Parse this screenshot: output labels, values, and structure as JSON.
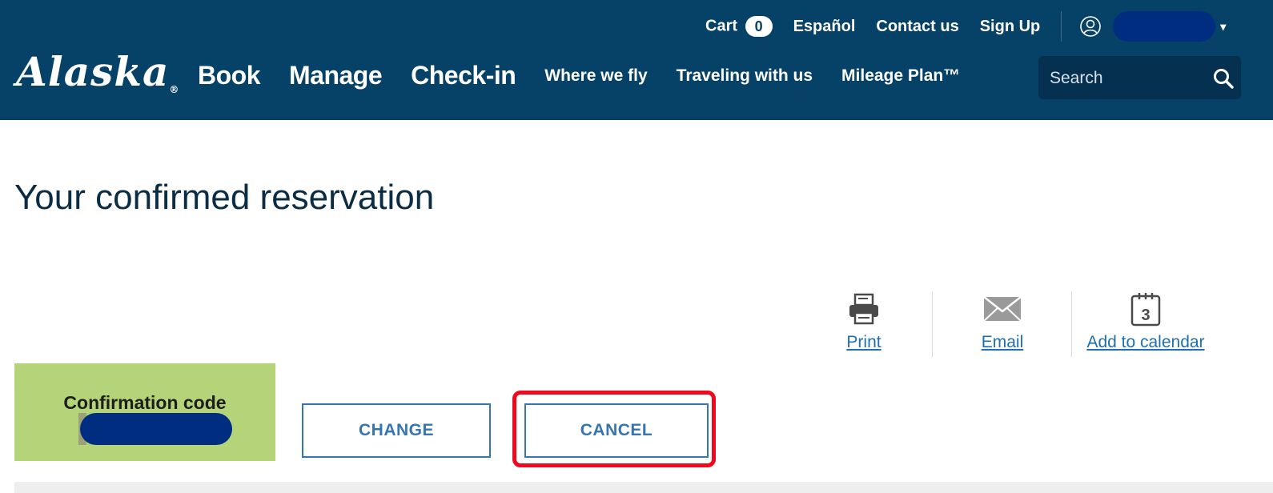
{
  "header": {
    "logo_text": "Alaska",
    "logo_mark": "®",
    "utility": {
      "cart_label": "Cart",
      "cart_count": "0",
      "espanol": "Español",
      "contact": "Contact us",
      "signup": "Sign Up",
      "user_icon": "user-circle-icon",
      "caret": "▾"
    },
    "nav": {
      "book": "Book",
      "manage": "Manage",
      "checkin": "Check-in",
      "where": "Where we fly",
      "traveling": "Traveling with us",
      "mileage": "Mileage Plan™"
    },
    "search": {
      "placeholder": "Search",
      "icon": "search-icon"
    }
  },
  "main": {
    "title": "Your confirmed reservation",
    "actions": {
      "print": "Print",
      "email": "Email",
      "calendar": "Add to calendar",
      "calendar_day": "3"
    },
    "confirmation": {
      "label": "Confirmation code"
    },
    "buttons": {
      "change": "CHANGE",
      "cancel": "CANCEL"
    }
  },
  "colors": {
    "header_bg": "#064167",
    "search_bg": "#05304f",
    "link": "#1f6fb2",
    "button": "#3575b2",
    "confirmation_bg": "#b5d47a",
    "highlight": "#ee0a1e",
    "redaction": "#002d80"
  }
}
